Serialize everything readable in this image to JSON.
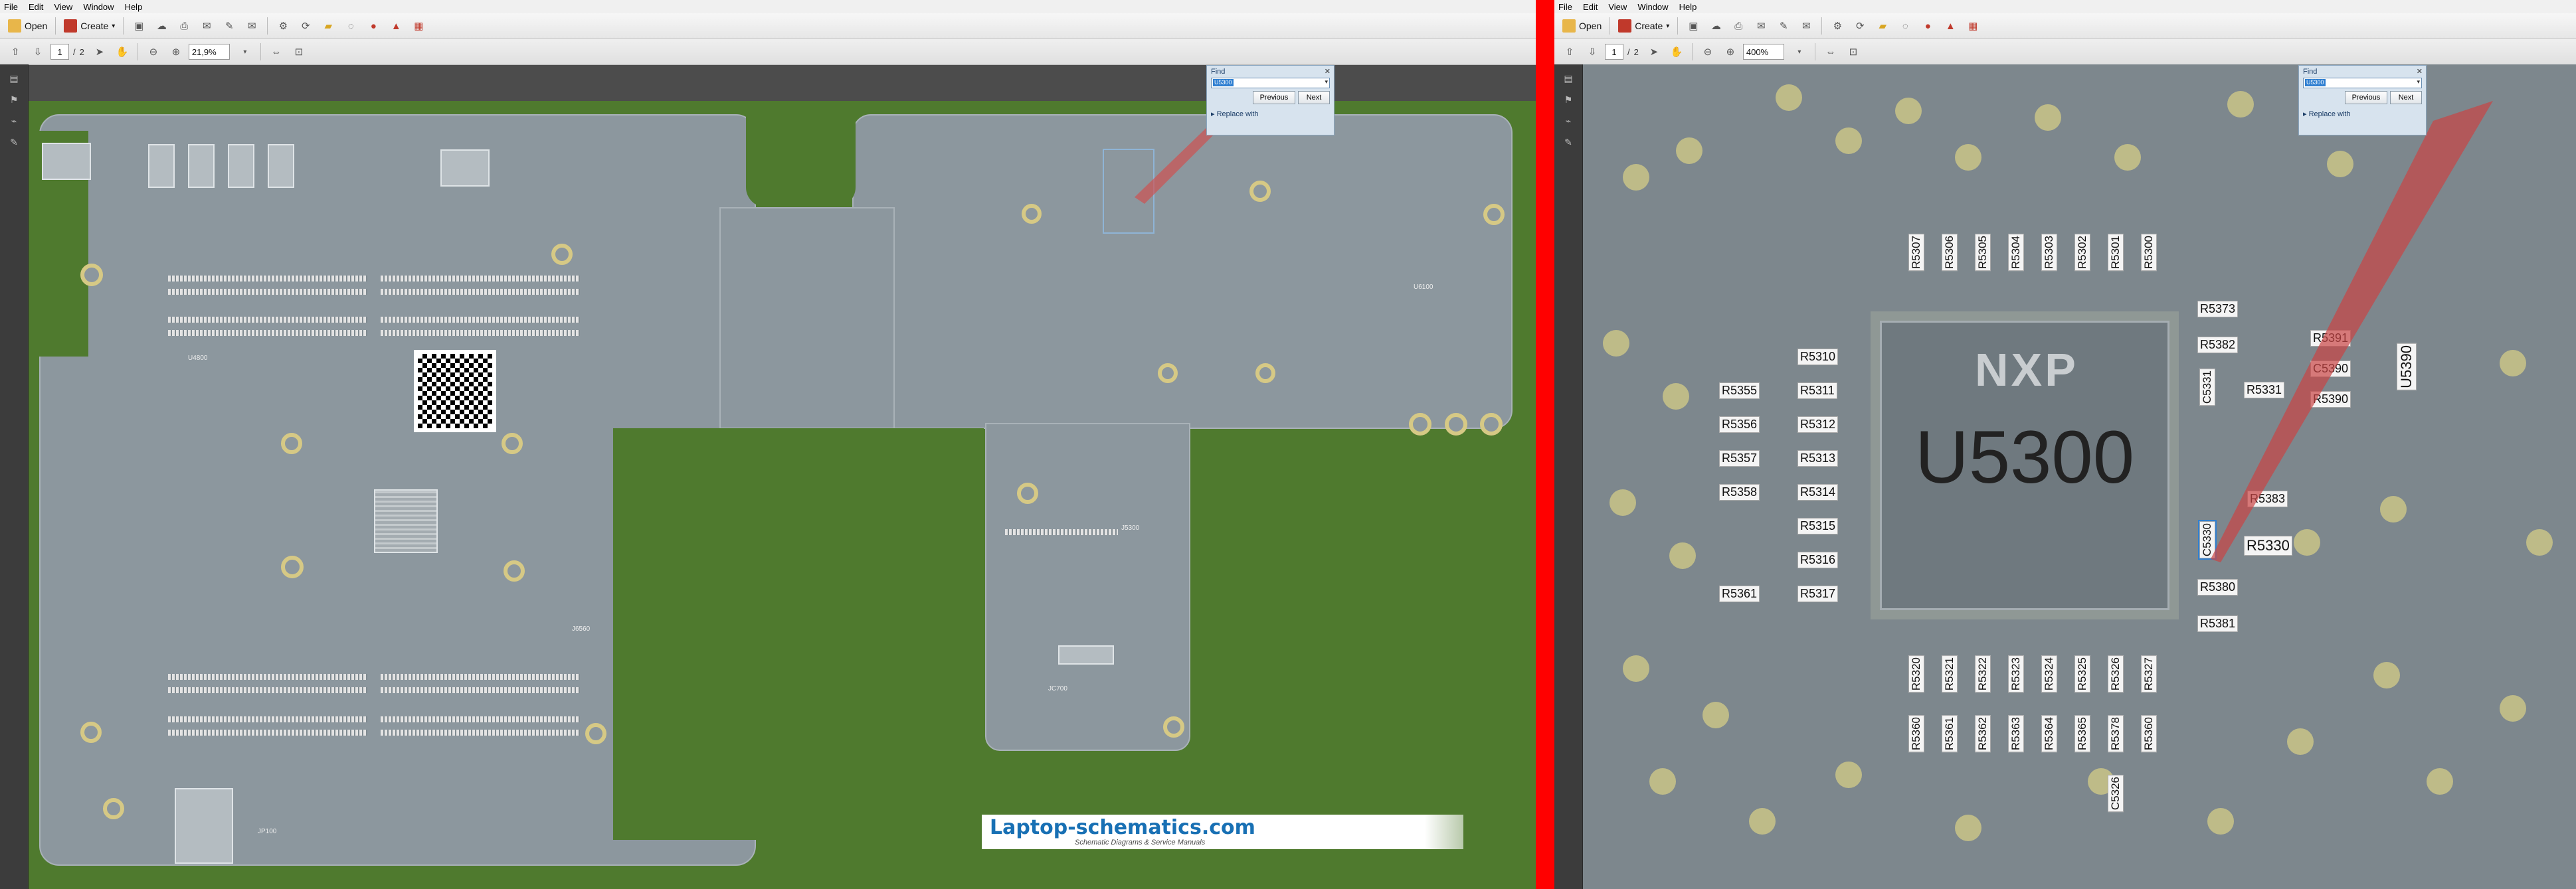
{
  "menu": [
    "File",
    "Edit",
    "View",
    "Window",
    "Help"
  ],
  "toolbar": {
    "open_label": "Open",
    "create_label": "Create"
  },
  "left": {
    "page_current": "1",
    "page_total": "2",
    "zoom": "21,9%",
    "board_labels": {
      "j6560": "J6560",
      "u4800": "U4800",
      "j7000": "J7000",
      "j5300": "J5300",
      "jc700": "JC700",
      "jp100": "JP100",
      "j6500": "J6500",
      "u6100": "U6100"
    }
  },
  "right": {
    "page_current": "1",
    "page_total": "2",
    "zoom": "400%"
  },
  "find": {
    "title": "Find",
    "query": "U5300",
    "previous_label": "Previous",
    "next_label": "Next",
    "replace_label": "Replace with"
  },
  "logo": {
    "text": "Laptop-schematics.com",
    "sub": "Schematic Diagrams & Service Manuals"
  },
  "zoomed_view": {
    "chip_label": "U5300",
    "chip_mark": "NXP",
    "top_row": [
      "R5307",
      "R5306",
      "R5305",
      "R5304",
      "R5303",
      "R5302",
      "R5301",
      "R5300"
    ],
    "left_col": [
      "R5310",
      "R5311",
      "R5312",
      "R5313",
      "R5314",
      "R5315",
      "R5316",
      "R5317"
    ],
    "far_left": [
      "R5355",
      "R5356",
      "R5357",
      "R5358",
      "R5361"
    ],
    "right_h": [
      "R5373",
      "R5382",
      "R5331",
      "R5383",
      "R5330",
      "R5380",
      "R5381",
      "R5391",
      "C5390",
      "R5390"
    ],
    "right_v": [
      "C5331",
      "C5330",
      "U5390"
    ],
    "bottom_top": [
      "R5320",
      "R5321",
      "R5322",
      "R5323",
      "R5324",
      "R5325",
      "R5326",
      "R5327"
    ],
    "bottom_bottom": [
      "R5360",
      "R5361",
      "R5362",
      "R5363",
      "R5364",
      "R5365",
      "R5378",
      "R5360"
    ],
    "bottom_extra": "C5326"
  },
  "colors": {
    "divider": "#ff0000",
    "board": "#8c979e",
    "pcb_green": "#4f7a2e",
    "highlight": "#2f7fd1"
  }
}
